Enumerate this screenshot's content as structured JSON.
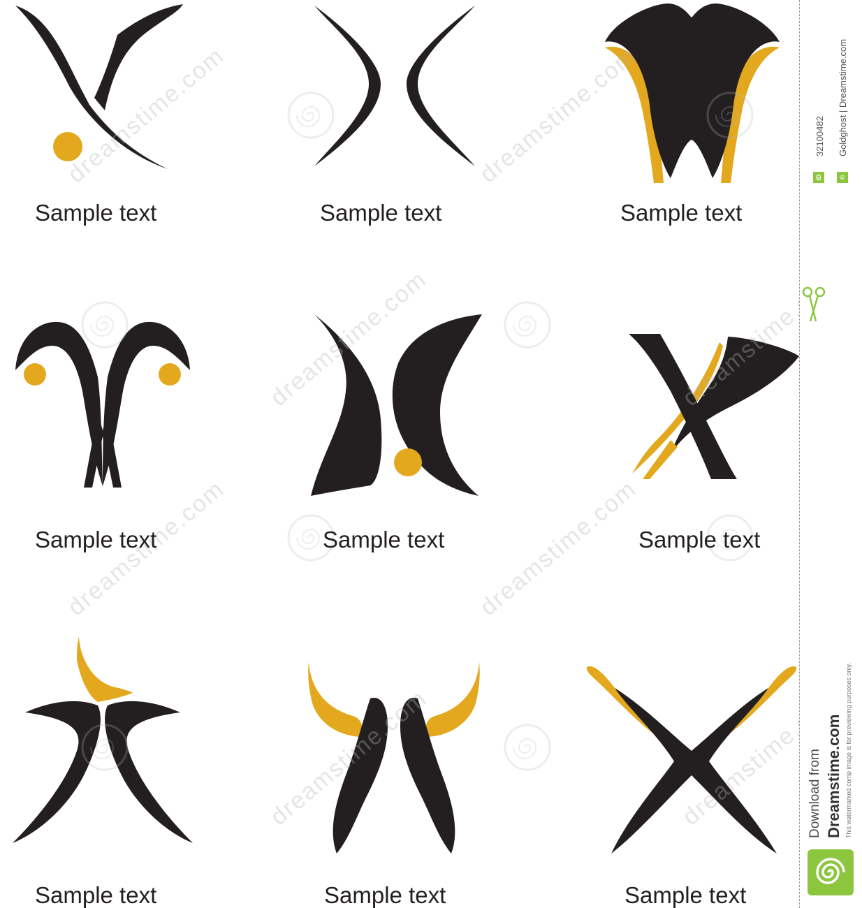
{
  "captions": [
    "Sample text",
    "Sample text",
    "Sample text",
    "Sample text",
    "Sample text",
    "Sample text",
    "Sample text",
    "Sample text",
    "Sample text"
  ],
  "colors": {
    "black": "#231f20",
    "gold": "#e3a81e",
    "brand_green": "#8cc63f"
  },
  "watermark": {
    "text": "dreamstime.com"
  },
  "sidebar": {
    "image_id": "32100482",
    "id_badge": "ID",
    "copyright_badge": "©",
    "credit": "Goldghost | Dreamstime.com",
    "download_from": "Download from",
    "brand": "Dreamstime.com",
    "disclaimer": "This watermarked comp image is for previewing purposes only."
  },
  "icons": [
    "scissors-icon",
    "dreamstime-spiral-logo-icon"
  ]
}
